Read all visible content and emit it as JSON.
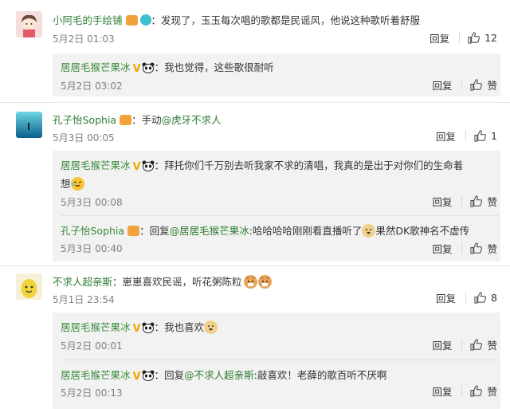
{
  "comments": [
    {
      "user": "小阿毛的手绘铺",
      "text": "：发现了，玉玉每次唱的歌都是民谣风，他说这种歌听着舒服",
      "time": "5月2日 01:03",
      "reply_label": "回复",
      "like_count": "12",
      "replies": [
        {
          "user": "居居毛猴芒果冰",
          "text": "：我也觉得，这些歌很耐听",
          "time": "5月2日 03:02",
          "reply_label": "回复",
          "like_label": "赞"
        }
      ]
    },
    {
      "user": "孔子怡Sophia",
      "text_prefix": "：手动",
      "mention": "@虎牙不求人",
      "time": "5月3日 00:05",
      "reply_label": "回复",
      "like_count": "1",
      "replies": [
        {
          "user": "居居毛猴芒果冰",
          "text": "：拜托你们千万别去听我家不求的清唱，我真的是出于对你们的生命着",
          "text_line2": "想",
          "time": "5月3日 00:08",
          "reply_label": "回复",
          "like_label": "赞"
        },
        {
          "user": "孔子怡Sophia",
          "text_prefix": "：回复",
          "mention": "@居居毛猴芒果冰",
          "text": ":哈哈哈哈刚刚看直播听了",
          "text_after": "果然DK歌神名不虚传",
          "time": "5月3日 00:40",
          "reply_label": "回复",
          "like_label": "赞"
        }
      ]
    },
    {
      "user": "不求人超亲斯",
      "text": "：崽崽喜欢民谣，听花粥陈粒",
      "time": "5月1日 23:54",
      "reply_label": "回复",
      "like_count": "8",
      "replies": [
        {
          "user": "居居毛猴芒果冰",
          "text": "：我也喜欢",
          "time": "5月2日 00:01",
          "reply_label": "回复",
          "like_label": "赞"
        },
        {
          "user": "居居毛猴芒果冰",
          "text_prefix": "：回复",
          "mention": "@不求人超亲斯",
          "text": ":敲喜欢！老薛的歌百听不厌啊",
          "time": "5月2日 00:13",
          "reply_label": "回复",
          "like_label": "赞"
        }
      ]
    }
  ]
}
